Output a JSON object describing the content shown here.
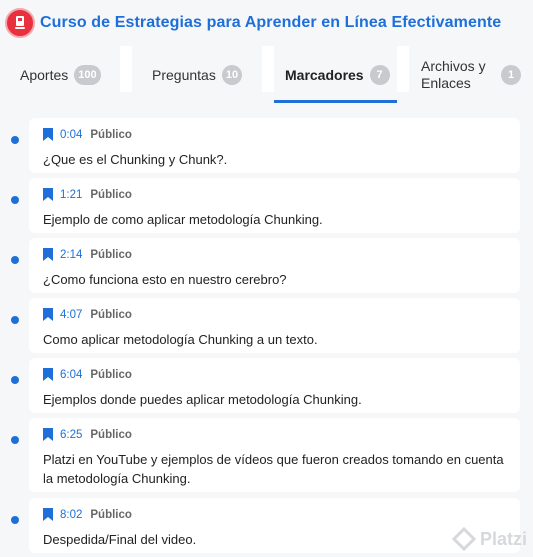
{
  "course": {
    "title": "Curso de Estrategias para Aprender en Línea Efectivamente",
    "icon": "course-badge-icon",
    "accent": "#1e6fd9",
    "badge_color": "#e8303f"
  },
  "tabs": [
    {
      "label": "Aportes",
      "count": "100"
    },
    {
      "label": "Preguntas",
      "count": "10"
    },
    {
      "label": "Marcadores",
      "count": "7",
      "active": true
    },
    {
      "label": "Archivos y Enlaces",
      "count": "1"
    }
  ],
  "bookmarks": [
    {
      "time": "0:04",
      "visibility": "Público",
      "text": "¿Que es el Chunking y Chunk?."
    },
    {
      "time": "1:21",
      "visibility": "Público",
      "text": "Ejemplo de como aplicar metodología Chunking."
    },
    {
      "time": "2:14",
      "visibility": "Público",
      "text": "¿Como funciona esto en nuestro cerebro?"
    },
    {
      "time": "4:07",
      "visibility": "Público",
      "text": "Como aplicar metodología Chunking a un texto."
    },
    {
      "time": "6:04",
      "visibility": "Público",
      "text": "Ejemplos donde puedes aplicar metodología Chunking."
    },
    {
      "time": "6:25",
      "visibility": "Público",
      "text": "Platzi en YouTube y ejemplos de vídeos que fueron creados tomando en cuenta la metodología Chunking."
    },
    {
      "time": "8:02",
      "visibility": "Público",
      "text": "Despedida/Final del video."
    }
  ],
  "watermark": {
    "text": "Platzi",
    "icon": "platzi-logo-icon"
  }
}
